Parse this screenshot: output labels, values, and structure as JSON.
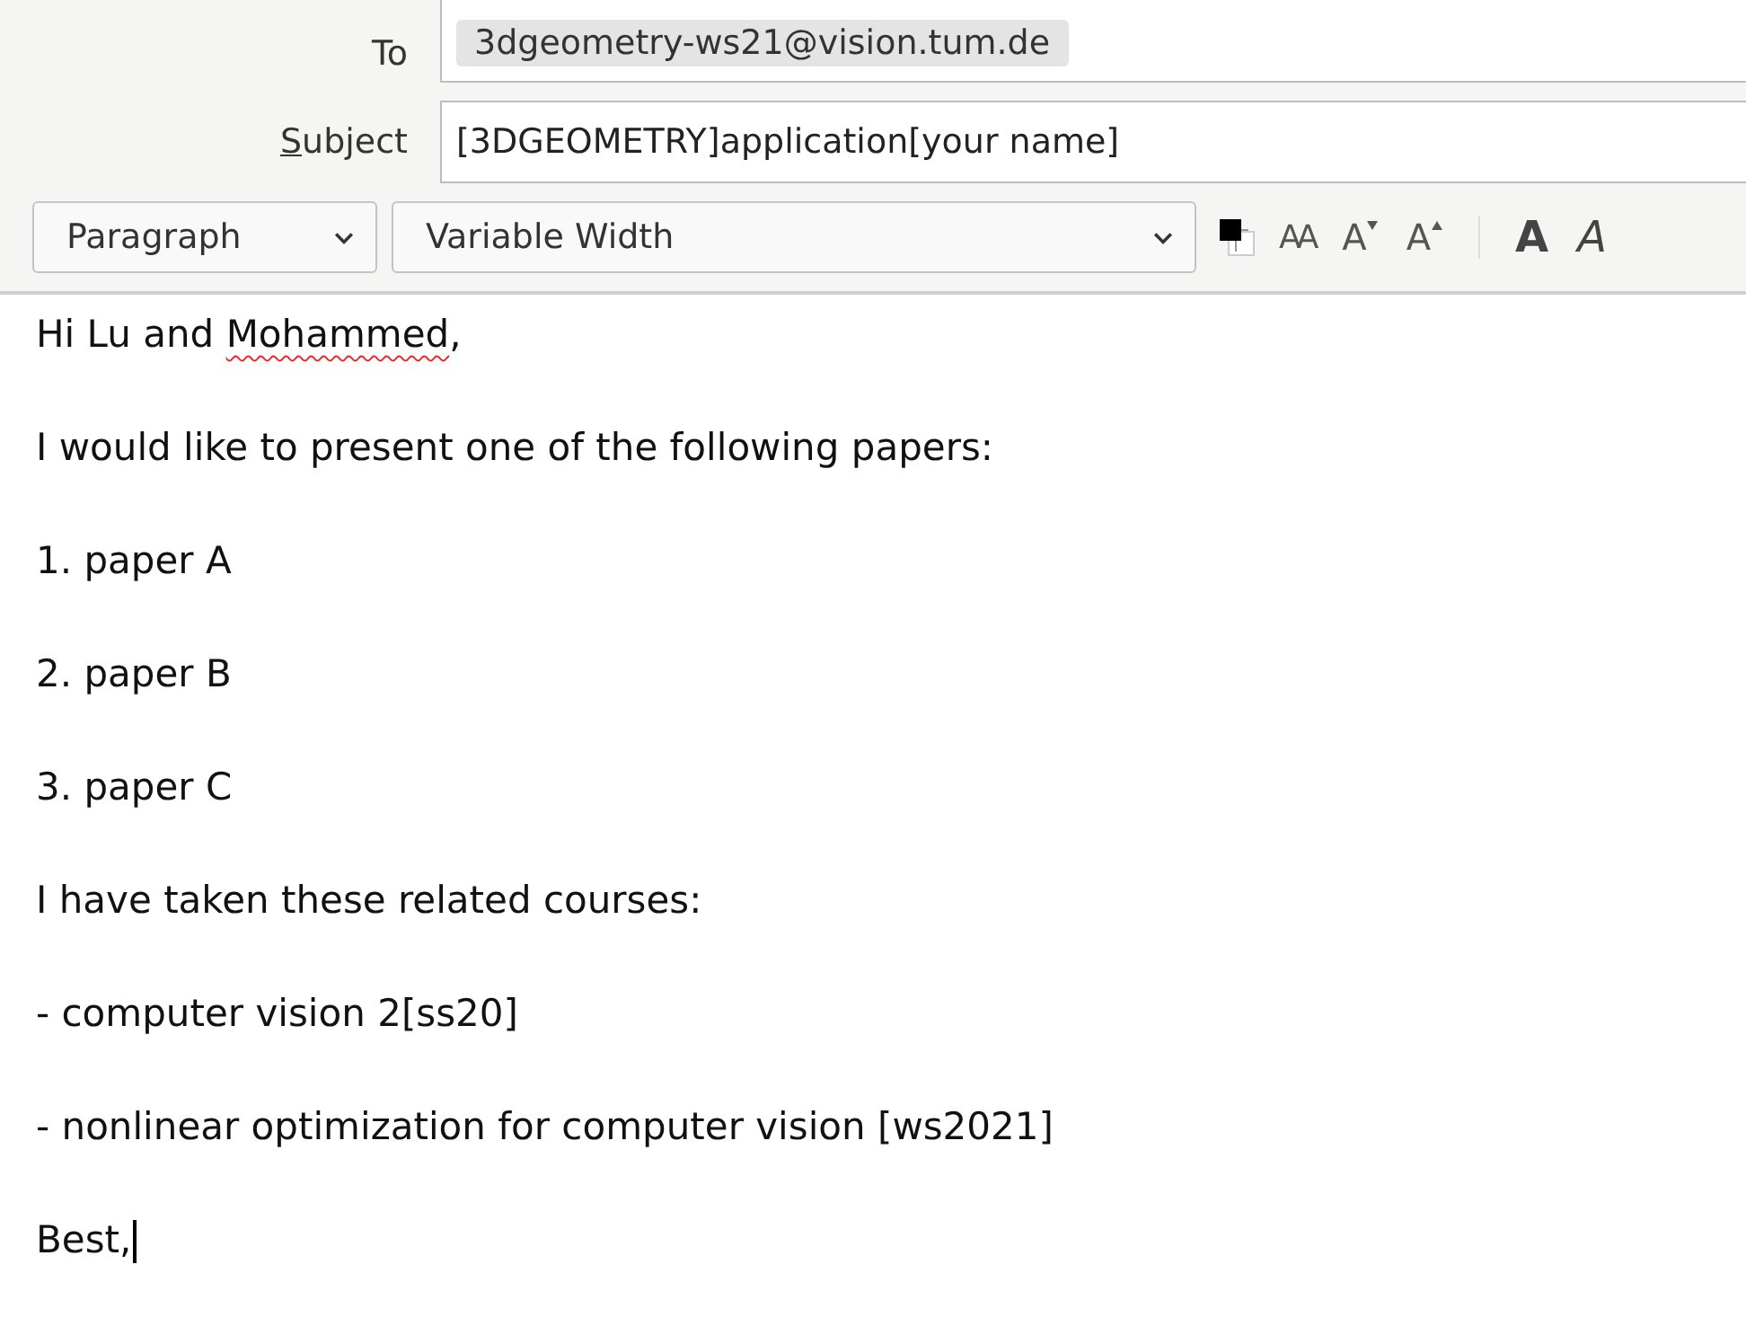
{
  "header": {
    "to": {
      "label": "To",
      "recipients": [
        "3dgeometry-ws21@vision.tum.de"
      ]
    },
    "subject": {
      "label": "Subject",
      "value": "[3DGEOMETRY]application[your name]"
    }
  },
  "toolbar": {
    "paragraph_format": "Paragraph",
    "font": "Variable Width",
    "buttons": [
      {
        "kind": "color"
      },
      {
        "kind": "reset-size",
        "label": "AA"
      },
      {
        "kind": "smaller",
        "label": "A"
      },
      {
        "kind": "larger",
        "label": "A"
      },
      {
        "kind": "bold",
        "label": "A"
      },
      {
        "kind": "italic",
        "label": "A"
      }
    ]
  },
  "body": [
    {
      "parts": [
        {
          "text": "Hi Lu and ",
          "misspelled": false
        },
        {
          "text": "Mohammed",
          "misspelled": true
        },
        {
          "text": ",",
          "misspelled": false
        }
      ],
      "cursor": false
    },
    {
      "parts": [
        {
          "text": "I would like to present one of the following papers:",
          "misspelled": false
        }
      ],
      "cursor": false
    },
    {
      "parts": [
        {
          "text": "1. paper A",
          "misspelled": false
        }
      ],
      "cursor": false
    },
    {
      "parts": [
        {
          "text": "2. paper B",
          "misspelled": false
        }
      ],
      "cursor": false
    },
    {
      "parts": [
        {
          "text": "3. paper C",
          "misspelled": false
        }
      ],
      "cursor": false
    },
    {
      "parts": [
        {
          "text": "I have taken these related courses:",
          "misspelled": false
        }
      ],
      "cursor": false
    },
    {
      "parts": [
        {
          "text": "- computer vision 2[ss20]",
          "misspelled": false
        }
      ],
      "cursor": false
    },
    {
      "parts": [
        {
          "text": "- nonlinear optimization for computer vision [ws2021]",
          "misspelled": false
        }
      ],
      "cursor": false
    },
    {
      "parts": [
        {
          "text": "Best,",
          "misspelled": false
        }
      ],
      "cursor": true
    }
  ]
}
